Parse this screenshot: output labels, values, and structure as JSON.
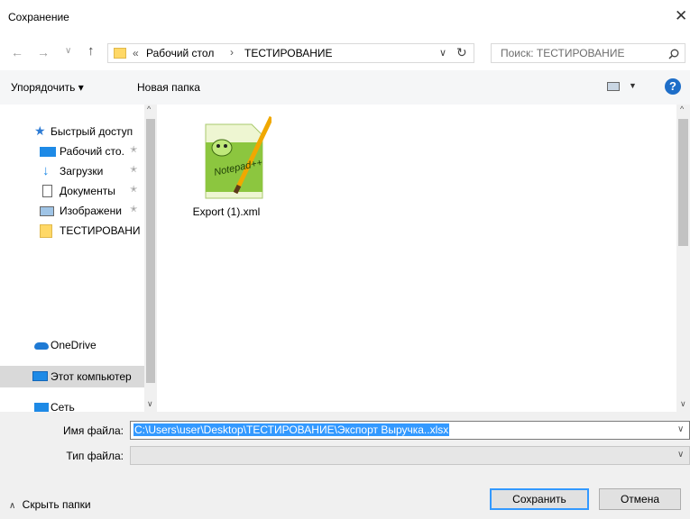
{
  "window": {
    "title": "Сохранение",
    "close_glyph": "✕"
  },
  "address": {
    "breadcrumb_prefix": "«",
    "crumbs": [
      "Рабочий стол",
      "ТЕСТИРОВАНИЕ"
    ],
    "separator": "›",
    "dropdown_glyph": "∨",
    "refresh_glyph": "↻"
  },
  "search": {
    "placeholder": "Поиск: ТЕСТИРОВАНИЕ",
    "icon": "search-icon"
  },
  "toolbar": {
    "organize_label": "Упорядочить ▾",
    "new_folder_label": "Новая папка",
    "help_glyph": "?"
  },
  "nav": {
    "items": [
      {
        "label": "Быстрый доступ",
        "icon": "star-icon"
      },
      {
        "label": "Рабочий сто.",
        "icon": "desktop-icon",
        "pin": "✭"
      },
      {
        "label": "Загрузки",
        "icon": "download-icon",
        "pin": "✭"
      },
      {
        "label": "Документы",
        "icon": "documents-icon",
        "pin": "✭"
      },
      {
        "label": "Изображени",
        "icon": "pictures-icon",
        "pin": "✭"
      },
      {
        "label": "ТЕСТИРОВАНИ",
        "icon": "folder-icon"
      },
      {
        "label": "OneDrive",
        "icon": "onedrive-icon"
      },
      {
        "label": "Этот компьютер",
        "icon": "computer-icon"
      },
      {
        "label": "Сеть",
        "icon": "network-icon"
      }
    ]
  },
  "files": [
    {
      "name": "Export (1).xml",
      "icon": "notepadpp-file-icon",
      "icon_text": "Notepad++"
    }
  ],
  "form": {
    "filename_label": "Имя файла:",
    "filename_value": "C:\\Users\\user\\Desktop\\ТЕСТИРОВАНИЕ\\Экспорт Выручка..xlsx",
    "filetype_label": "Тип файла:",
    "filetype_value": ""
  },
  "footer": {
    "hide_folders_label": "Скрыть папки",
    "save_label": "Сохранить",
    "cancel_label": "Отмена"
  },
  "colors": {
    "accent": "#3399ff",
    "selection": "#cce8ff",
    "help": "#1e6ec8"
  }
}
